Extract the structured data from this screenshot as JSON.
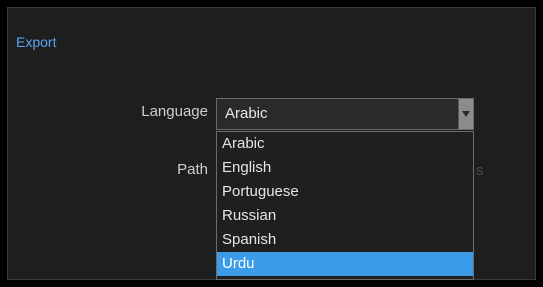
{
  "dialog": {
    "title": "Export"
  },
  "language": {
    "label": "Language",
    "selected": "Arabic",
    "options": [
      "Arabic",
      "English",
      "Portuguese",
      "Russian",
      "Spanish",
      "Urdu"
    ],
    "highlighted": "Urdu"
  },
  "path": {
    "label": "Path",
    "trailing_text": "s"
  },
  "colors": {
    "accent": "#3c9be8",
    "title": "#5aa6f0",
    "background": "#1e1e1e"
  }
}
